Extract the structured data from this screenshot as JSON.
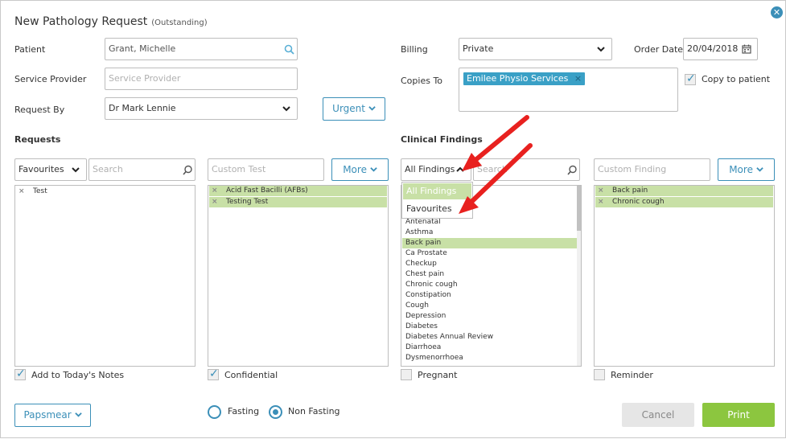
{
  "dialog": {
    "title": "New Pathology Request",
    "subtitle": "(Outstanding)",
    "close_glyph": "✕"
  },
  "patient": {
    "label": "Patient",
    "value": "Grant, Michelle",
    "icon": "search-icon"
  },
  "service_provider": {
    "label": "Service Provider",
    "placeholder": "Service Provider"
  },
  "request_by": {
    "label": "Request By",
    "value": "Dr Mark Lennie"
  },
  "urgent_button": {
    "label": "Urgent"
  },
  "billing": {
    "label": "Billing",
    "value": "Private"
  },
  "order_date": {
    "label": "Order Date",
    "value": "20/04/2018",
    "icon": "calendar-icon"
  },
  "copies_to": {
    "label": "Copies To",
    "tags": [
      {
        "label": "Emilee Physio Services"
      }
    ],
    "tag_remove_glyph": "×"
  },
  "copy_to_patient": {
    "label": "Copy to patient",
    "checked": true
  },
  "requests": {
    "title": "Requests",
    "filter": {
      "value": "Favourites"
    },
    "search": {
      "placeholder": "Search"
    },
    "available": [
      {
        "label": "Test"
      }
    ],
    "custom": {
      "placeholder": "Custom Test"
    },
    "more_label": "More",
    "selected": [
      {
        "label": "Acid Fast Bacilli (AFBs)"
      },
      {
        "label": "Testing Test"
      }
    ],
    "remove_glyph": "×"
  },
  "clinical_findings": {
    "title": "Clinical Findings",
    "filter": {
      "value": "All Findings",
      "options": [
        {
          "label": "All Findings",
          "selected": true
        },
        {
          "label": "Favourites",
          "selected": false
        }
      ]
    },
    "search": {
      "placeholder": "Search"
    },
    "available": [
      {
        "label": "Antenatal",
        "selected": false
      },
      {
        "label": "Asthma",
        "selected": false
      },
      {
        "label": "Back pain",
        "selected": true
      },
      {
        "label": "Ca Prostate",
        "selected": false
      },
      {
        "label": "Checkup",
        "selected": false
      },
      {
        "label": "Chest pain",
        "selected": false
      },
      {
        "label": "Chronic cough",
        "selected": false
      },
      {
        "label": "Constipation",
        "selected": false
      },
      {
        "label": "Cough",
        "selected": false
      },
      {
        "label": "Depression",
        "selected": false
      },
      {
        "label": "Diabetes",
        "selected": false
      },
      {
        "label": "Diabetes Annual Review",
        "selected": false
      },
      {
        "label": "Diarrhoea",
        "selected": false
      },
      {
        "label": "Dysmenorrhoea",
        "selected": false
      }
    ],
    "custom": {
      "placeholder": "Custom Finding"
    },
    "more_label": "More",
    "selected": [
      {
        "label": "Back pain"
      },
      {
        "label": "Chronic cough"
      }
    ],
    "remove_glyph": "×"
  },
  "options": {
    "add_to_notes": {
      "label": "Add to Today's Notes",
      "checked": true
    },
    "confidential": {
      "label": "Confidential",
      "checked": true
    },
    "pregnant": {
      "label": "Pregnant",
      "checked": false
    },
    "reminder": {
      "label": "Reminder",
      "checked": false
    }
  },
  "papsmear_button": {
    "label": "Papsmear"
  },
  "fasting": {
    "fasting_label": "Fasting",
    "non_fasting_label": "Non Fasting",
    "selected": "Non Fasting"
  },
  "footer": {
    "cancel_label": "Cancel",
    "print_label": "Print"
  },
  "colors": {
    "accent": "#3b8fb8",
    "selected_row": "#c8e0a6",
    "print_button": "#8cc63f",
    "cancel_button": "#e6e6e6",
    "annotation_arrow": "#e8211f",
    "tag": "#3aa0c6"
  }
}
